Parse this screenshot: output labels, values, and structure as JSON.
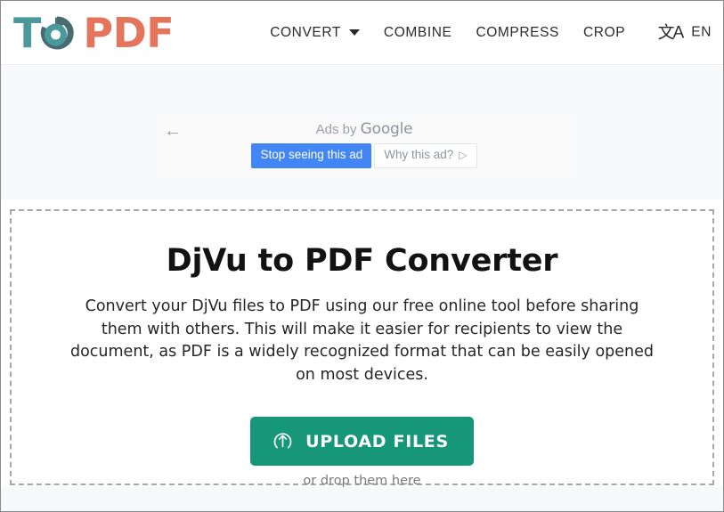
{
  "header": {
    "logo": {
      "text_primary": "T",
      "mark_icon": "refresh-circle-icon",
      "text_secondary": "PDF",
      "color_teal": "#4a9a9b",
      "color_coral": "#e4745c"
    },
    "nav": [
      {
        "label": "CONVERT",
        "has_dropdown": true
      },
      {
        "label": "COMBINE",
        "has_dropdown": false
      },
      {
        "label": "COMPRESS",
        "has_dropdown": false
      },
      {
        "label": "CROP",
        "has_dropdown": false
      }
    ],
    "language": {
      "icon": "translate-icon",
      "glyph": "文A",
      "label": "EN"
    }
  },
  "ad": {
    "back_arrow": "←",
    "attribution_prefix": "Ads by ",
    "attribution_brand": "Google",
    "stop_button": "Stop seeing this ad",
    "why_button": "Why this ad?",
    "why_glyph": "▷",
    "stop_button_color": "#4285f4"
  },
  "main": {
    "title": "DjVu to PDF Converter",
    "description": "Convert your DjVu files to PDF using our free online tool before sharing them with others. This will make it easier for recipients to view the document, as PDF is a widely recognized format that can be easily opened on most devices.",
    "upload_button_label": "UPLOAD FILES",
    "upload_button_icon": "upload-arrow-circle-icon",
    "upload_button_color": "#16977a",
    "drop_hint": "or drop them here"
  }
}
